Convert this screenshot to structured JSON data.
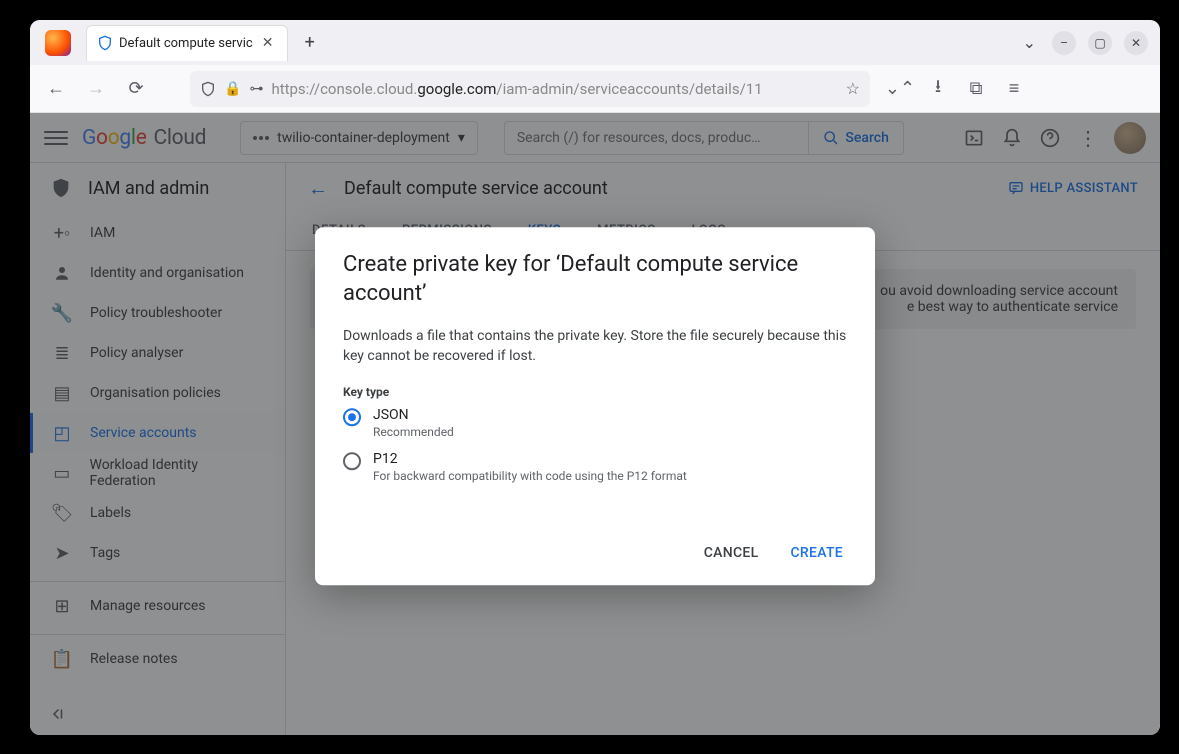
{
  "browser": {
    "tab_title": "Default compute servic",
    "url_prefix": "https://",
    "url_mid": "console.cloud.",
    "url_host": "google.com",
    "url_path": "/iam-admin/serviceaccounts/details/11"
  },
  "header": {
    "logo_cloud": "Cloud",
    "project": "twilio-container-deployment",
    "search_placeholder": "Search (/) for resources, docs, produc…",
    "search_label": "Search"
  },
  "sidebar": {
    "title": "IAM and admin",
    "items": [
      {
        "label": "IAM"
      },
      {
        "label": "Identity and organisation"
      },
      {
        "label": "Policy troubleshooter"
      },
      {
        "label": "Policy analyser"
      },
      {
        "label": "Organisation policies"
      },
      {
        "label": "Service accounts"
      },
      {
        "label": "Workload Identity Federation"
      },
      {
        "label": "Labels"
      },
      {
        "label": "Tags"
      }
    ],
    "manage": "Manage resources",
    "release": "Release notes"
  },
  "page": {
    "title": "Default compute service account",
    "help": "HELP ASSISTANT",
    "tabs": [
      "DETAILS",
      "PERMISSIONS",
      "KEYS",
      "METRICS",
      "LOGS"
    ],
    "info_line1": "ou avoid downloading service account",
    "info_line2": "e best way to authenticate service"
  },
  "dialog": {
    "title": "Create private key for ‘Default compute service account’",
    "desc": "Downloads a file that contains the private key. Store the file securely because this key cannot be recovered if lost.",
    "key_type_label": "Key type",
    "options": [
      {
        "title": "JSON",
        "sub": "Recommended"
      },
      {
        "title": "P12",
        "sub": "For backward compatibility with code using the P12 format"
      }
    ],
    "cancel": "CANCEL",
    "create": "CREATE"
  }
}
